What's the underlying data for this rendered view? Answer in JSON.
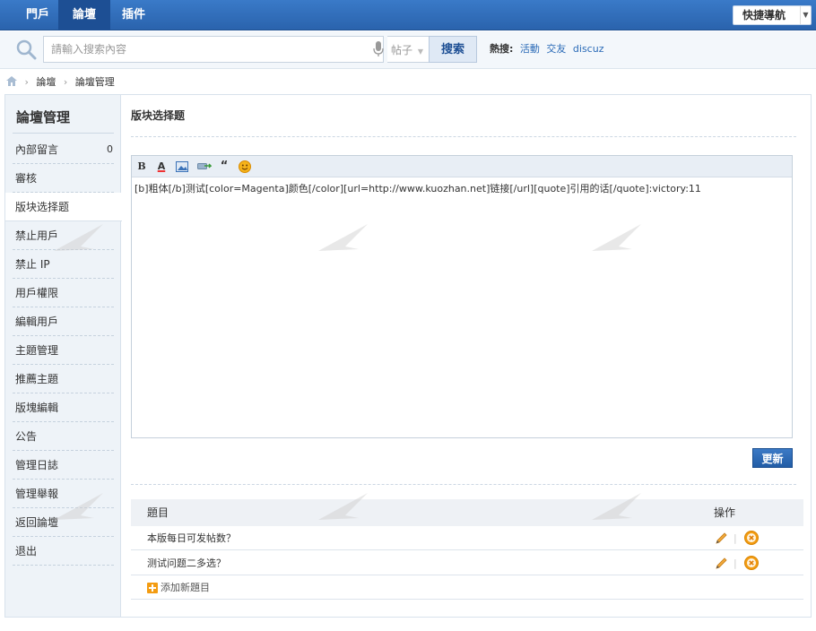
{
  "nav": {
    "tabs": [
      {
        "label": "門戶"
      },
      {
        "label": "論壇"
      },
      {
        "label": "插件"
      }
    ],
    "quick_nav": "快捷導航"
  },
  "search": {
    "placeholder": "請輸入搜索內容",
    "type": "帖子",
    "button": "搜索",
    "hot_label": "熱搜:",
    "hot_links": [
      "活動",
      "交友",
      "discuz"
    ]
  },
  "breadcrumb": {
    "items": [
      "論壇",
      "論壇管理"
    ]
  },
  "sidebar": {
    "title": "論壇管理",
    "items": [
      {
        "label": "內部留言",
        "count": "0"
      },
      {
        "label": "審核"
      },
      {
        "label": "版块选择题"
      },
      {
        "label": "禁止用戶"
      },
      {
        "label": "禁止 IP"
      },
      {
        "label": "用戶權限"
      },
      {
        "label": "編輯用戶"
      },
      {
        "label": "主題管理"
      },
      {
        "label": "推薦主題"
      },
      {
        "label": "版塊編輯"
      },
      {
        "label": "公告"
      },
      {
        "label": "管理日誌"
      },
      {
        "label": "管理舉報"
      },
      {
        "label": "返回論壇"
      },
      {
        "label": "退出"
      }
    ]
  },
  "main": {
    "section_title": "版块选择题",
    "toolbar": {
      "bold": "B",
      "font_color": "A",
      "quote": "“"
    },
    "editor_text": "[b]粗体[/b]测试[color=Magenta]颜色[/color][url=http://www.kuozhan.net]链接[/url][quote]引用的话[/quote]:victory:11",
    "update_button": "更新",
    "questions": {
      "header_title": "題目",
      "header_op": "操作",
      "rows": [
        {
          "title": "本版每日可发帖数？"
        },
        {
          "title": "测试问题二多选？"
        }
      ],
      "separator": "|",
      "add_link": "添加新題目"
    }
  },
  "colors": {
    "nav_bg": "#2a63ad",
    "accent": "#1d4f94",
    "sidebar_bg": "#eef3f8",
    "delete_icon": "#f39c12"
  }
}
